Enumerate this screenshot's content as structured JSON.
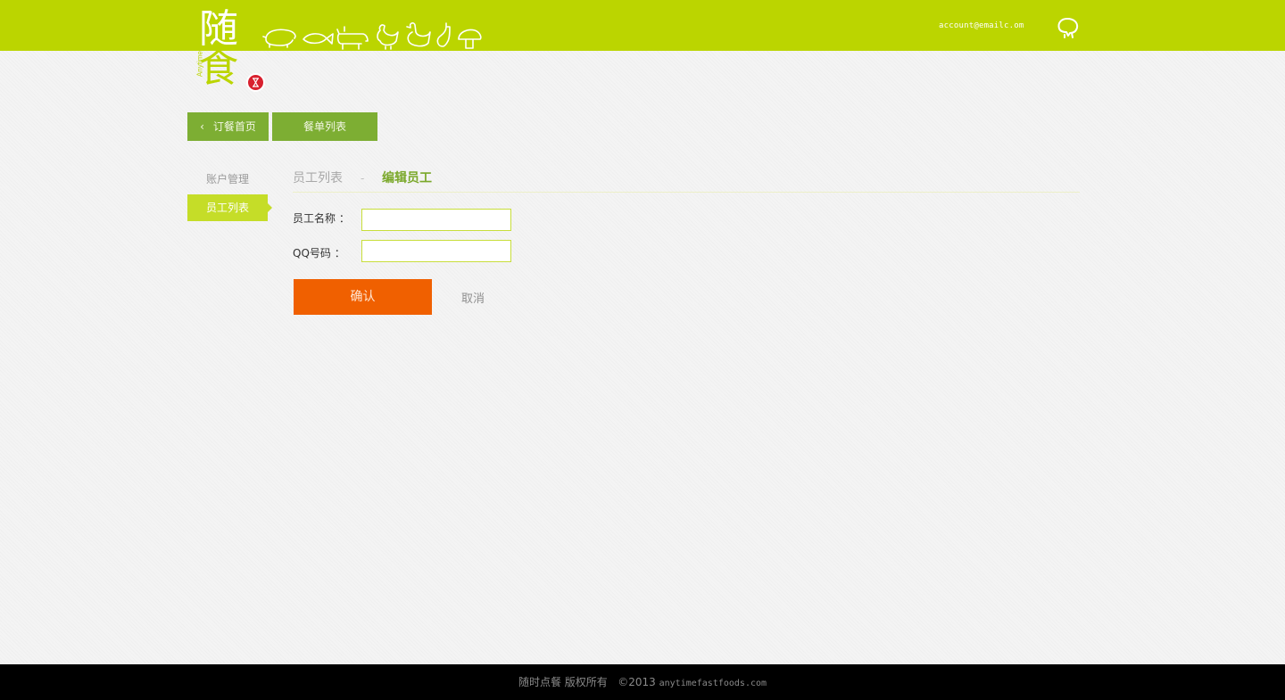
{
  "header": {
    "logo_text_1": "随",
    "logo_text_2": "食",
    "logo_subtitle": "Anytime Fast Food",
    "account": "account@emailc.om",
    "brand_color": "#bbd500"
  },
  "nav": {
    "home_label": "订餐首页",
    "menu_label": "餐单列表"
  },
  "sidebar": {
    "items": [
      {
        "label": "账户管理"
      },
      {
        "label": "员工列表",
        "active": true
      }
    ]
  },
  "breadcrumb": {
    "list": "员工列表",
    "sep": "-",
    "current": "编辑员工"
  },
  "form": {
    "name_label": "员工名称 ：",
    "name_value": "",
    "qq_label": "QQ号码 ：",
    "qq_value": "",
    "confirm_label": "确认",
    "cancel_label": "取消"
  },
  "footer": {
    "text": "随时点餐 版权所有",
    "copyright": "©2013",
    "domain": "anytimefastfoods.com"
  },
  "colors": {
    "accent_green": "#7dae33",
    "sidebar_active": "#c5dd28",
    "confirm": "#f06000"
  }
}
